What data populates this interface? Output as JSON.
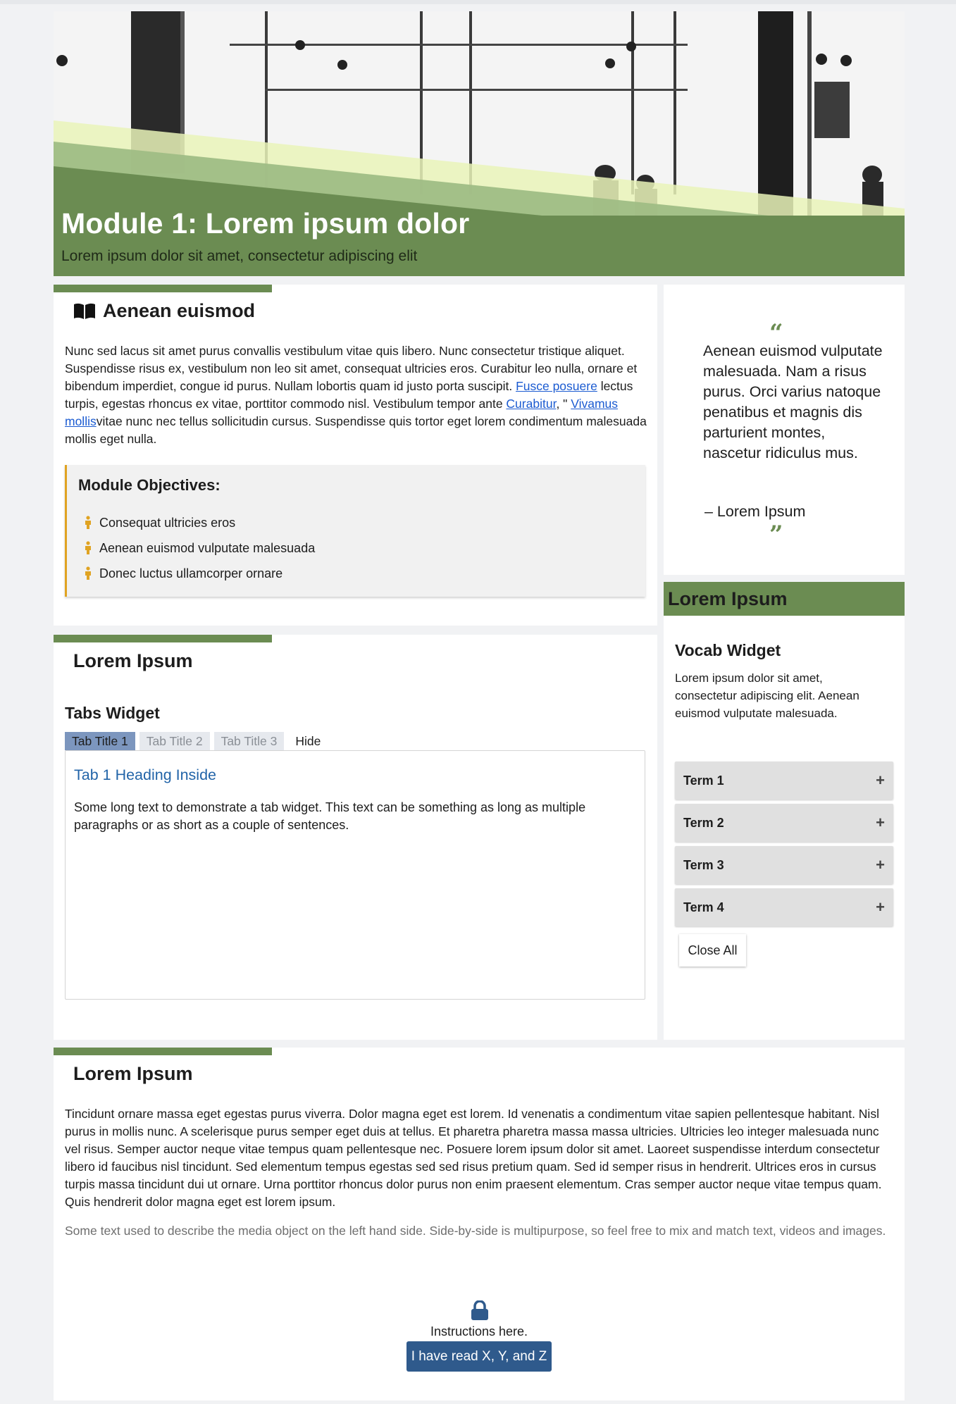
{
  "hero": {
    "title": "Module 1: Lorem ipsum dolor",
    "subtitle": "Lorem ipsum dolor sit amet, consectetur adipiscing elit"
  },
  "section1": {
    "heading": "Aenean euismod",
    "icon": "book-icon",
    "paragraph": {
      "part1": "Nunc sed lacus sit amet purus convallis vestibulum vitae quis libero. Nunc consectetur tristique aliquet. Suspendisse risus ex, vestibulum non leo sit amet, consequat ultricies eros. Curabitur leo nulla, ornare et bibendum imperdiet, congue id purus. Nullam lobortis quam id justo porta suscipit. ",
      "link1": "Fusce posuere",
      "part2": " lectus turpis, egestas rhoncus ex vitae, porttitor commodo nisl. Vestibulum tempor ante ",
      "link2": "Curabitur",
      "part3": ", \" ",
      "link3": "Vivamus mollis",
      "part4": "vitae nunc nec tellus sollicitudin cursus. Suspendisse quis tortor eget lorem condimentum malesuada mollis eget nulla."
    },
    "objectives": {
      "heading": "Module Objectives:",
      "items": [
        "Consequat ultricies eros",
        "Aenean euismod vulputate malesuada",
        "Donec luctus ullamcorper ornare"
      ]
    }
  },
  "quote": {
    "open_mark": "“",
    "close_mark": "”",
    "text": "Aenean euismod vulputate malesuada. Nam a risus purus. Orci varius natoque penatibus et magnis dis parturient montes, nascetur ridiculus mus.",
    "author": "– Lorem Ipsum"
  },
  "section2": {
    "heading": "Lorem Ipsum",
    "tabs_title": "Tabs Widget",
    "tabs": [
      "Tab Title 1",
      "Tab Title 2",
      "Tab Title 3"
    ],
    "hide_label": "Hide",
    "panel_heading": "Tab 1 Heading Inside",
    "panel_text": "Some long text to demonstrate a tab widget. This text can be something as long as multiple paragraphs or as short as a couple of sentences."
  },
  "vocab": {
    "header": "Lorem Ipsum",
    "title": "Vocab Widget",
    "description": "Lorem ipsum dolor sit amet, consectetur adipiscing elit. Aenean euismod vulputate malesuada.",
    "terms": [
      "Term 1",
      "Term 2",
      "Term 3",
      "Term 4"
    ],
    "plus": "+",
    "close_all": "Close All"
  },
  "section3": {
    "heading": "Lorem Ipsum",
    "paragraph": "Tincidunt ornare massa eget egestas purus viverra. Dolor magna eget est lorem. Id venenatis a condimentum vitae sapien pellentesque habitant. Nisl purus in mollis nunc. A scelerisque purus semper eget duis at tellus. Et pharetra pharetra massa massa ultricies. Ultricies leo integer malesuada nunc vel risus. Semper auctor neque vitae tempus quam pellentesque nec. Posuere lorem ipsum dolor sit amet. Laoreet suspendisse interdum consectetur libero id faucibus nisl tincidunt. Sed elementum tempus egestas sed sed risus pretium quam. Sed id semper risus in hendrerit. Ultrices eros in cursus turpis massa tincidunt dui ut ornare. Urna porttitor rhoncus dolor purus non enim praesent elementum. Cras semper auctor neque vitae tempus quam. Quis hendrerit dolor magna eget est lorem ipsum.",
    "media_text": "Some text used to describe the media object on the left hand side. Side-by-side is multipurpose, so feel free to mix and match text, videos and images.",
    "instructions": "Instructions here.",
    "button": "I have read X, Y, and Z",
    "lock_icon": "lock-icon"
  },
  "colors": {
    "accent_green": "#6b8c52",
    "objective_orange": "#e0a322",
    "link_blue": "#1b5bd1",
    "button_blue": "#2f5a8c",
    "active_tab": "#7c96be"
  }
}
